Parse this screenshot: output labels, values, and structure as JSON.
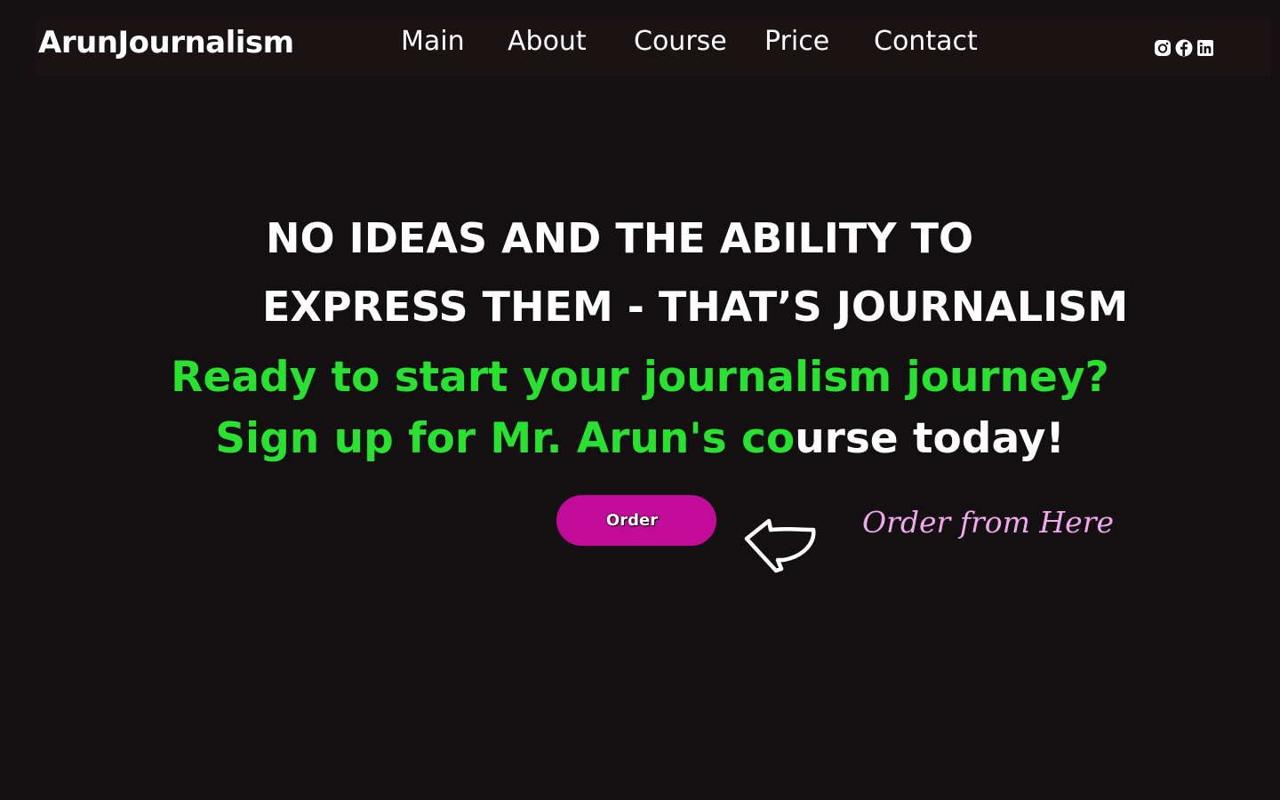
{
  "header": {
    "brand": "ArunJournalism",
    "nav": [
      {
        "label": "Main"
      },
      {
        "label": "About"
      },
      {
        "label": "Course"
      },
      {
        "label": "Price"
      },
      {
        "label": "Contact"
      }
    ],
    "social_icons": [
      "instagram-icon",
      "facebook-icon",
      "linkedin-icon"
    ]
  },
  "hero": {
    "headline_line1": "NO IDEAS AND THE ABILITY  TO",
    "headline_line2": "EXPRESS THEM - THAT’S JOURNALISM",
    "cta_line1": "Ready to start your journalism journey?",
    "cta_line2_green": "Sign up for Mr. Arun's co",
    "cta_line2_white": "urse today!"
  },
  "order": {
    "button_label": "Order",
    "hint": "Order from Here"
  },
  "colors": {
    "background": "#141012",
    "accent_green": "#29e22f",
    "button": "#c20c99",
    "hint_pink": "#f0a8ee"
  }
}
